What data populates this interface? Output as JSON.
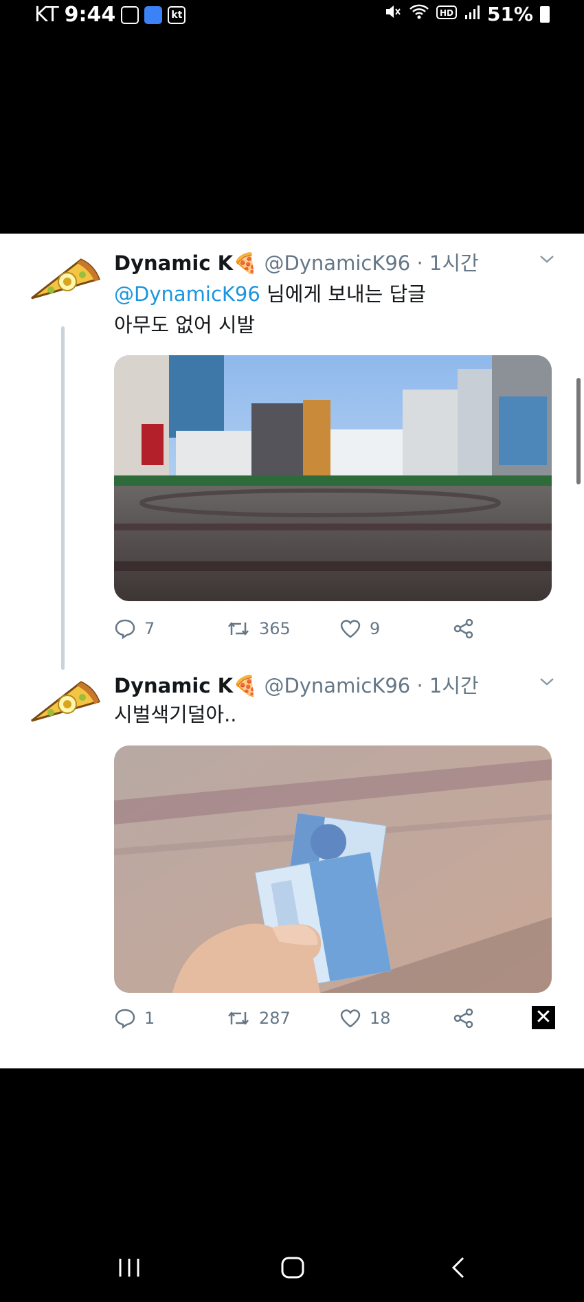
{
  "status_bar": {
    "carrier": "KT",
    "time": "9:44",
    "battery": "51%",
    "icons": [
      "gallery-icon",
      "app-icon",
      "kt-icon",
      "mute-icon",
      "wifi-icon",
      "hd-icon",
      "signal-icon",
      "battery-icon"
    ]
  },
  "tweets": [
    {
      "name": "Dynamic K",
      "name_emoji": "🍕",
      "handle": "@DynamicK96",
      "separator": "·",
      "time": "1시간",
      "reply_mention": "@DynamicK96",
      "reply_suffix": " 님에게 보내는 답글",
      "text": "아무도 없어 시발",
      "replies": "7",
      "retweets": "365",
      "likes": "9"
    },
    {
      "name": "Dynamic K",
      "name_emoji": "🍕",
      "handle": "@DynamicK96",
      "separator": "·",
      "time": "1시간",
      "text": "시벌색기덜아..",
      "replies": "1",
      "retweets": "287",
      "likes": "18"
    }
  ],
  "colors": {
    "link": "#1b95e0",
    "muted": "#657786",
    "text": "#14171a"
  }
}
